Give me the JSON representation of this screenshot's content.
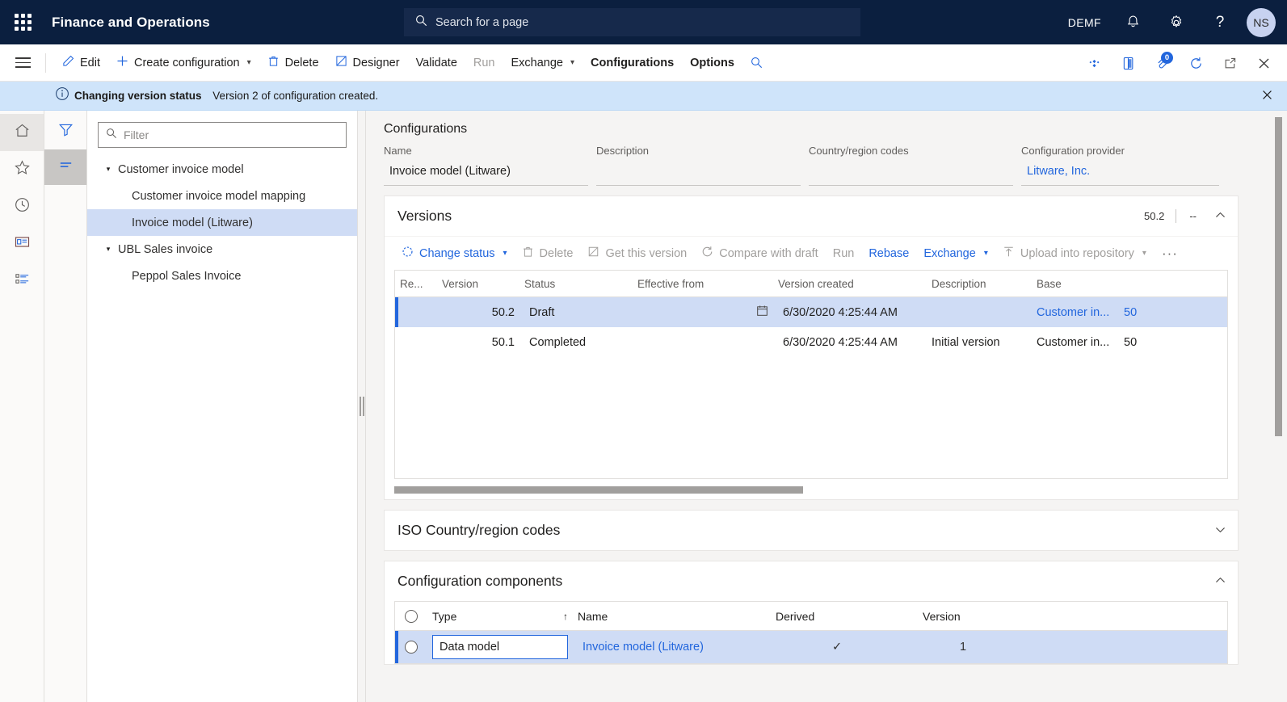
{
  "topbar": {
    "waffle_icon": "app-launcher-icon",
    "app_title": "Finance and Operations",
    "search_placeholder": "Search for a page",
    "company_code": "DEMF",
    "notifications_icon": "bell-icon",
    "settings_icon": "gear-icon",
    "help_icon": "question-mark-icon",
    "avatar_initials": "NS",
    "bg_color": "#0b1f3f",
    "search_bg": "#16294b",
    "avatar_bg": "#c7d2f0"
  },
  "commandbar": {
    "menu_icon": "hamburger-icon",
    "buttons": [
      {
        "label": "Edit",
        "icon": "pencil-icon",
        "disabled": false,
        "caret": false,
        "bold": false
      },
      {
        "label": "Create configuration",
        "icon": "plus-icon",
        "disabled": false,
        "caret": true,
        "bold": false
      },
      {
        "label": "Delete",
        "icon": "trash-icon",
        "disabled": false,
        "caret": false,
        "bold": false
      },
      {
        "label": "Designer",
        "icon": "designer-icon",
        "disabled": false,
        "caret": false,
        "bold": false
      },
      {
        "label": "Validate",
        "icon": "none",
        "disabled": false,
        "caret": false,
        "bold": false
      },
      {
        "label": "Run",
        "icon": "none",
        "disabled": true,
        "caret": false,
        "bold": false
      },
      {
        "label": "Exchange",
        "icon": "none",
        "disabled": false,
        "caret": true,
        "bold": false
      },
      {
        "label": "Configurations",
        "icon": "none",
        "disabled": false,
        "caret": false,
        "bold": true
      },
      {
        "label": "Options",
        "icon": "none",
        "disabled": false,
        "caret": false,
        "bold": true
      }
    ],
    "search_icon": "search-icon",
    "right_icons": [
      {
        "name": "personalize-icon"
      },
      {
        "name": "office-app-icon"
      },
      {
        "name": "attachment-icon",
        "badge": "0"
      },
      {
        "name": "refresh-icon"
      },
      {
        "name": "popout-icon"
      },
      {
        "name": "close-icon"
      }
    ],
    "badge_color": "#2266dd"
  },
  "messagebar": {
    "icon": "info-icon",
    "title": "Changing version status",
    "text": "Version 2 of configuration created.",
    "close_icon": "close-icon",
    "bg_color": "#cfe4fa"
  },
  "rail": {
    "items": [
      {
        "name": "home-icon",
        "active": true
      },
      {
        "name": "favorites-star-icon",
        "active": false
      },
      {
        "name": "recent-clock-icon",
        "active": false
      },
      {
        "name": "workspaces-icon",
        "active": false
      },
      {
        "name": "modules-list-icon",
        "active": false
      }
    ]
  },
  "filter_rail": {
    "items": [
      {
        "name": "filter-funnel-icon",
        "active": false
      },
      {
        "name": "list-lines-icon",
        "active": true
      }
    ]
  },
  "tree": {
    "filter_placeholder": "Filter",
    "filter_value": "",
    "search_icon": "search-icon",
    "nodes": [
      {
        "label": "Customer invoice model",
        "level": 0,
        "expandable": true,
        "selected": false
      },
      {
        "label": "Customer invoice model mapping",
        "level": 1,
        "expandable": false,
        "selected": false
      },
      {
        "label": "Invoice model (Litware)",
        "level": 1,
        "expandable": false,
        "selected": true
      },
      {
        "label": "UBL Sales invoice",
        "level": 0,
        "expandable": true,
        "selected": false
      },
      {
        "label": "Peppol Sales Invoice",
        "level": 1,
        "expandable": false,
        "selected": false
      }
    ]
  },
  "main": {
    "section_caption": "Configurations",
    "fields": [
      {
        "label": "Name",
        "value": "Invoice model (Litware)",
        "link": false
      },
      {
        "label": "Description",
        "value": "",
        "link": false
      },
      {
        "label": "Country/region codes",
        "value": "",
        "link": false
      },
      {
        "label": "Configuration provider",
        "value": "Litware, Inc.",
        "link": true
      }
    ]
  },
  "versions": {
    "title": "Versions",
    "meta_version": "50.2",
    "meta_secondary": "--",
    "collapse_icon": "chevron-up-icon",
    "toolbar": [
      {
        "label": "Change status",
        "icon": "status-circle-icon",
        "disabled": false,
        "caret": true
      },
      {
        "label": "Delete",
        "icon": "trash-icon",
        "disabled": true,
        "caret": false
      },
      {
        "label": "Get this version",
        "icon": "get-version-icon",
        "disabled": true,
        "caret": false
      },
      {
        "label": "Compare with draft",
        "icon": "compare-icon",
        "disabled": true,
        "caret": false
      },
      {
        "label": "Run",
        "icon": "none",
        "disabled": true,
        "caret": false
      },
      {
        "label": "Rebase",
        "icon": "none",
        "disabled": false,
        "caret": false
      },
      {
        "label": "Exchange",
        "icon": "none",
        "disabled": false,
        "caret": true
      },
      {
        "label": "Upload into repository",
        "icon": "upload-icon",
        "disabled": true,
        "caret": true
      }
    ],
    "overflow_label": "···",
    "columns": [
      "Re...",
      "Version",
      "Status",
      "Effective from",
      "Version created",
      "Description",
      "Base",
      ""
    ],
    "rows": [
      {
        "selected": true,
        "re": "",
        "version": "50.2",
        "status": "Draft",
        "effective_from": "",
        "effective_icon": "calendar-icon",
        "version_created": "6/30/2020 4:25:44 AM",
        "description": "",
        "base": "Customer in...",
        "base_link": true,
        "base_num": "50",
        "base_num_link": true
      },
      {
        "selected": false,
        "re": "",
        "version": "50.1",
        "status": "Completed",
        "effective_from": "",
        "effective_icon": "none",
        "version_created": "6/30/2020 4:25:44 AM",
        "description": "Initial version",
        "base": "Customer in...",
        "base_link": false,
        "base_num": "50",
        "base_num_link": false
      }
    ]
  },
  "iso_section": {
    "title": "ISO Country/region codes",
    "expand_icon": "chevron-down-icon"
  },
  "components_section": {
    "title": "Configuration components",
    "collapse_icon": "chevron-up-icon",
    "columns": [
      "Type",
      "Name",
      "Derived",
      "Version"
    ],
    "sort_column": "Type",
    "sort_icon": "sort-ascending-icon",
    "select_all_icon": "radio-circle-icon",
    "rows": [
      {
        "selected": true,
        "type": "Data model",
        "type_editing": true,
        "name": "Invoice model (Litware)",
        "name_link": true,
        "derived": "✓",
        "version": "1"
      }
    ]
  },
  "colors": {
    "accent_blue": "#2266dd",
    "selection_blue": "#cfdcf5",
    "nav_dark": "#0b1f3f",
    "page_bg": "#f5f4f3"
  }
}
